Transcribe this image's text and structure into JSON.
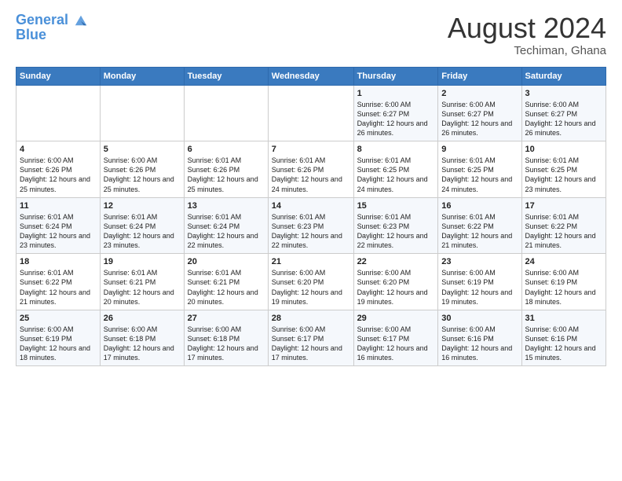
{
  "logo": {
    "line1": "General",
    "line2": "Blue"
  },
  "title": "August 2024",
  "subtitle": "Techiman, Ghana",
  "days_of_week": [
    "Sunday",
    "Monday",
    "Tuesday",
    "Wednesday",
    "Thursday",
    "Friday",
    "Saturday"
  ],
  "weeks": [
    [
      {
        "day": "",
        "info": ""
      },
      {
        "day": "",
        "info": ""
      },
      {
        "day": "",
        "info": ""
      },
      {
        "day": "",
        "info": ""
      },
      {
        "day": "1",
        "info": "Sunrise: 6:00 AM\nSunset: 6:27 PM\nDaylight: 12 hours\nand 26 minutes."
      },
      {
        "day": "2",
        "info": "Sunrise: 6:00 AM\nSunset: 6:27 PM\nDaylight: 12 hours\nand 26 minutes."
      },
      {
        "day": "3",
        "info": "Sunrise: 6:00 AM\nSunset: 6:27 PM\nDaylight: 12 hours\nand 26 minutes."
      }
    ],
    [
      {
        "day": "4",
        "info": "Sunrise: 6:00 AM\nSunset: 6:26 PM\nDaylight: 12 hours\nand 25 minutes."
      },
      {
        "day": "5",
        "info": "Sunrise: 6:00 AM\nSunset: 6:26 PM\nDaylight: 12 hours\nand 25 minutes."
      },
      {
        "day": "6",
        "info": "Sunrise: 6:01 AM\nSunset: 6:26 PM\nDaylight: 12 hours\nand 25 minutes."
      },
      {
        "day": "7",
        "info": "Sunrise: 6:01 AM\nSunset: 6:26 PM\nDaylight: 12 hours\nand 24 minutes."
      },
      {
        "day": "8",
        "info": "Sunrise: 6:01 AM\nSunset: 6:25 PM\nDaylight: 12 hours\nand 24 minutes."
      },
      {
        "day": "9",
        "info": "Sunrise: 6:01 AM\nSunset: 6:25 PM\nDaylight: 12 hours\nand 24 minutes."
      },
      {
        "day": "10",
        "info": "Sunrise: 6:01 AM\nSunset: 6:25 PM\nDaylight: 12 hours\nand 23 minutes."
      }
    ],
    [
      {
        "day": "11",
        "info": "Sunrise: 6:01 AM\nSunset: 6:24 PM\nDaylight: 12 hours\nand 23 minutes."
      },
      {
        "day": "12",
        "info": "Sunrise: 6:01 AM\nSunset: 6:24 PM\nDaylight: 12 hours\nand 23 minutes."
      },
      {
        "day": "13",
        "info": "Sunrise: 6:01 AM\nSunset: 6:24 PM\nDaylight: 12 hours\nand 22 minutes."
      },
      {
        "day": "14",
        "info": "Sunrise: 6:01 AM\nSunset: 6:23 PM\nDaylight: 12 hours\nand 22 minutes."
      },
      {
        "day": "15",
        "info": "Sunrise: 6:01 AM\nSunset: 6:23 PM\nDaylight: 12 hours\nand 22 minutes."
      },
      {
        "day": "16",
        "info": "Sunrise: 6:01 AM\nSunset: 6:22 PM\nDaylight: 12 hours\nand 21 minutes."
      },
      {
        "day": "17",
        "info": "Sunrise: 6:01 AM\nSunset: 6:22 PM\nDaylight: 12 hours\nand 21 minutes."
      }
    ],
    [
      {
        "day": "18",
        "info": "Sunrise: 6:01 AM\nSunset: 6:22 PM\nDaylight: 12 hours\nand 21 minutes."
      },
      {
        "day": "19",
        "info": "Sunrise: 6:01 AM\nSunset: 6:21 PM\nDaylight: 12 hours\nand 20 minutes."
      },
      {
        "day": "20",
        "info": "Sunrise: 6:01 AM\nSunset: 6:21 PM\nDaylight: 12 hours\nand 20 minutes."
      },
      {
        "day": "21",
        "info": "Sunrise: 6:00 AM\nSunset: 6:20 PM\nDaylight: 12 hours\nand 19 minutes."
      },
      {
        "day": "22",
        "info": "Sunrise: 6:00 AM\nSunset: 6:20 PM\nDaylight: 12 hours\nand 19 minutes."
      },
      {
        "day": "23",
        "info": "Sunrise: 6:00 AM\nSunset: 6:19 PM\nDaylight: 12 hours\nand 19 minutes."
      },
      {
        "day": "24",
        "info": "Sunrise: 6:00 AM\nSunset: 6:19 PM\nDaylight: 12 hours\nand 18 minutes."
      }
    ],
    [
      {
        "day": "25",
        "info": "Sunrise: 6:00 AM\nSunset: 6:19 PM\nDaylight: 12 hours\nand 18 minutes."
      },
      {
        "day": "26",
        "info": "Sunrise: 6:00 AM\nSunset: 6:18 PM\nDaylight: 12 hours\nand 17 minutes."
      },
      {
        "day": "27",
        "info": "Sunrise: 6:00 AM\nSunset: 6:18 PM\nDaylight: 12 hours\nand 17 minutes."
      },
      {
        "day": "28",
        "info": "Sunrise: 6:00 AM\nSunset: 6:17 PM\nDaylight: 12 hours\nand 17 minutes."
      },
      {
        "day": "29",
        "info": "Sunrise: 6:00 AM\nSunset: 6:17 PM\nDaylight: 12 hours\nand 16 minutes."
      },
      {
        "day": "30",
        "info": "Sunrise: 6:00 AM\nSunset: 6:16 PM\nDaylight: 12 hours\nand 16 minutes."
      },
      {
        "day": "31",
        "info": "Sunrise: 6:00 AM\nSunset: 6:16 PM\nDaylight: 12 hours\nand 15 minutes."
      }
    ]
  ]
}
